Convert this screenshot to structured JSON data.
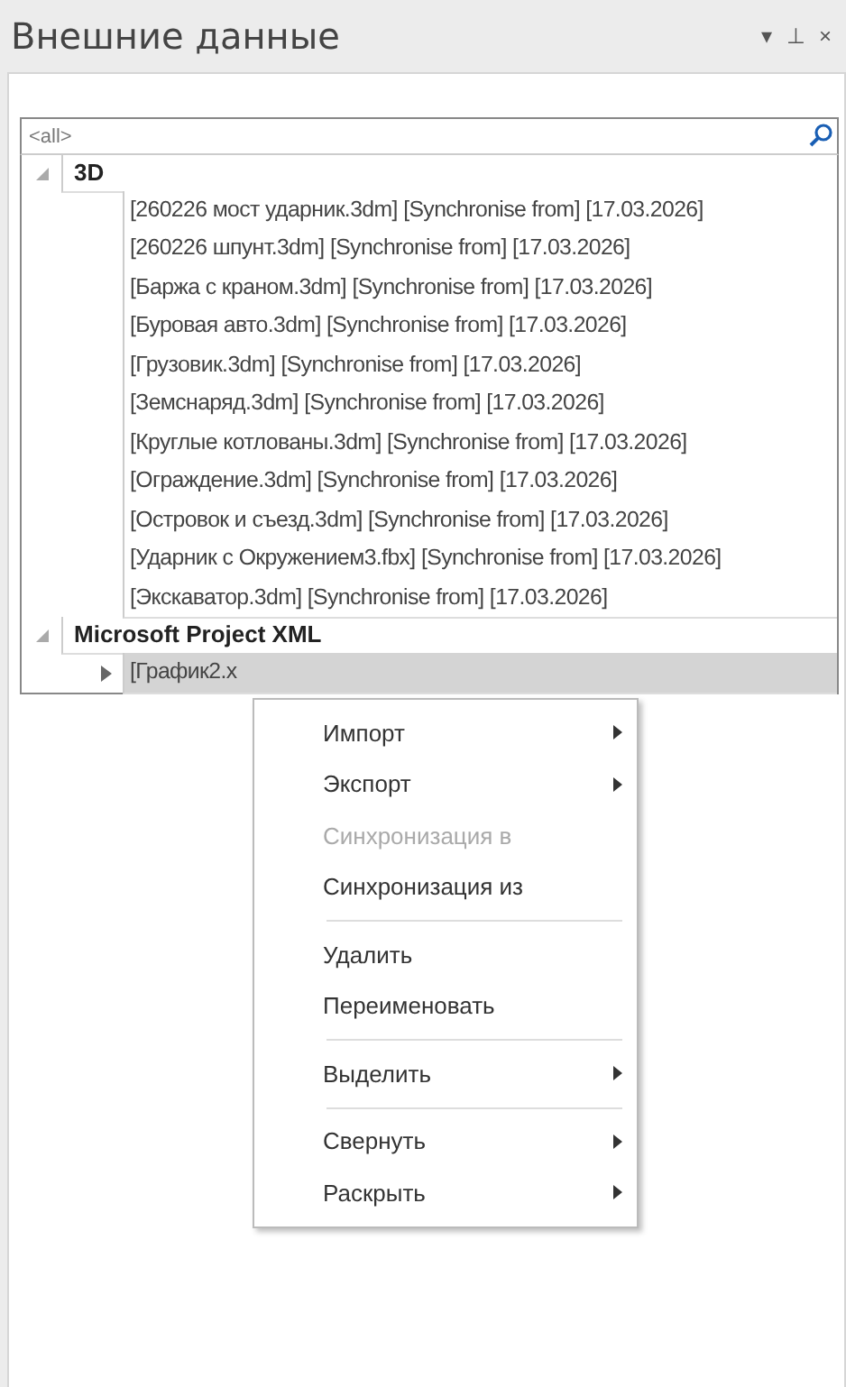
{
  "window": {
    "title": "Внешние данные",
    "controls": [
      "▾",
      "⊥",
      "×"
    ]
  },
  "search": {
    "placeholder": "<all>"
  },
  "groups": [
    {
      "label": "3D",
      "expanded": true,
      "items": [
        {
          "label": "[260226 мост ударник.3dm] [Synchronise from] [17.03.2026]",
          "selected": false
        },
        {
          "label": "[260226 шпунт.3dm] [Synchronise from] [17.03.2026]",
          "selected": false
        },
        {
          "label": "[Баржа с краном.3dm] [Synchronise from] [17.03.2026]",
          "selected": false
        },
        {
          "label": "[Буровая авто.3dm] [Synchronise from] [17.03.2026]",
          "selected": false
        },
        {
          "label": "[Грузовик.3dm] [Synchronise from] [17.03.2026]",
          "selected": false
        },
        {
          "label": "[Земснаряд.3dm] [Synchronise from] [17.03.2026]",
          "selected": false
        },
        {
          "label": "[Круглые котлованы.3dm] [Synchronise from] [17.03.2026]",
          "selected": false
        },
        {
          "label": "[Ограждение.3dm] [Synchronise from] [17.03.2026]",
          "selected": false
        },
        {
          "label": "[Островок и съезд.3dm] [Synchronise from] [17.03.2026]",
          "selected": false
        },
        {
          "label": "[Ударник с Окружением3.fbx] [Synchronise from] [17.03.2026]",
          "selected": false
        },
        {
          "label": "[Экскаватор.3dm] [Synchronise from] [17.03.2026]",
          "selected": false
        }
      ]
    },
    {
      "label": "Microsoft Project XML",
      "expanded": true,
      "items": [
        {
          "label": "[График2.x",
          "selected": true,
          "expandable": true
        }
      ]
    }
  ],
  "context_menu": [
    {
      "kind": "item",
      "label": "Импорт",
      "submenu": true,
      "disabled": false
    },
    {
      "kind": "item",
      "label": "Экспорт",
      "submenu": true,
      "disabled": false
    },
    {
      "kind": "item",
      "label": "Синхронизация в",
      "submenu": false,
      "disabled": true
    },
    {
      "kind": "item",
      "label": "Синхронизация из",
      "submenu": false,
      "disabled": false
    },
    {
      "kind": "separator"
    },
    {
      "kind": "item",
      "label": "Удалить",
      "submenu": false,
      "disabled": false
    },
    {
      "kind": "item",
      "label": "Переименовать",
      "submenu": false,
      "disabled": false
    },
    {
      "kind": "separator"
    },
    {
      "kind": "item",
      "label": "Выделить",
      "submenu": true,
      "disabled": false
    },
    {
      "kind": "separator"
    },
    {
      "kind": "item",
      "label": "Свернуть",
      "submenu": true,
      "disabled": false
    },
    {
      "kind": "item",
      "label": "Раскрыть",
      "submenu": true,
      "disabled": false
    }
  ]
}
